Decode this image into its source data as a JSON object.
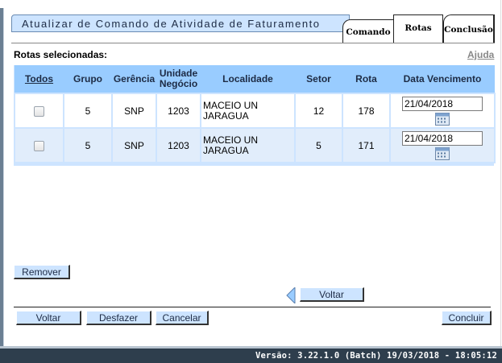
{
  "header": {
    "title": "Atualizar de Comando de Atividade de Faturamento",
    "tabs": [
      "Comando",
      "Rotas",
      "Conclusão"
    ]
  },
  "section": {
    "label": "Rotas selecionadas:",
    "help_link": "Ajuda"
  },
  "table": {
    "columns": [
      "Todos",
      "Grupo",
      "Gerência",
      "Unidade Negócio",
      "Localidade",
      "Setor",
      "Rota",
      "Data Vencimento"
    ],
    "rows": [
      {
        "grupo": "5",
        "gerencia": "SNP",
        "unidade": "1203",
        "localidade": "MACEIO UN JARAGUA",
        "setor": "12",
        "rota": "178",
        "data": "21/04/2018"
      },
      {
        "grupo": "5",
        "gerencia": "SNP",
        "unidade": "1203",
        "localidade": "MACEIO UN JARAGUA",
        "setor": "5",
        "rota": "171",
        "data": "21/04/2018"
      }
    ]
  },
  "buttons": {
    "remover": "Remover",
    "voltar_nav": "Voltar",
    "voltar": "Voltar",
    "desfazer": "Desfazer",
    "cancelar": "Cancelar",
    "concluir": "Concluir"
  },
  "footer": {
    "version": "Versão: 3.22.1.0 (Batch) 19/03/2018 - 18:05:12"
  },
  "icons": {
    "calendar": "calendar-icon",
    "back_arrow": "left-triangle-icon"
  }
}
